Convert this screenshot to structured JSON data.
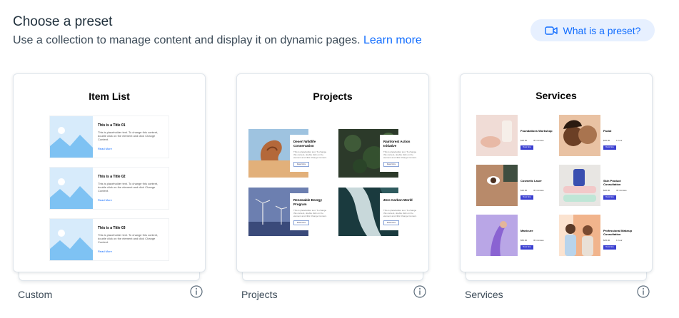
{
  "header": {
    "title": "Choose a preset",
    "subtitle": "Use a collection to manage content and display it on dynamic pages.",
    "learn_more": "Learn more",
    "help_button": "What is a preset?"
  },
  "presets": [
    {
      "title": "Item List",
      "footer": "Custom",
      "items": [
        {
          "title": "This is a Title 01",
          "desc": "This is placeholder text. To change this content, double click on the element and click Change Content.",
          "link": "Read More"
        },
        {
          "title": "This is a Title 02",
          "desc": "This is placeholder text. To change this content, double click on the element and click Change Content.",
          "link": "Read More"
        },
        {
          "title": "This is a Title 03",
          "desc": "This is placeholder text. To change this content, double click on the element and click Change Content.",
          "link": "Read More"
        }
      ]
    },
    {
      "title": "Projects",
      "footer": "Projects",
      "items": [
        {
          "name": "Desert Wildlife Conservation",
          "desc": "This is placeholder text. To change this content, double click on the element and click Change Content.",
          "button": "Read More"
        },
        {
          "name": "Rainforest Action Initiative",
          "desc": "This is placeholder text. To change this content, double click on the element and click Change Content.",
          "button": "Read More"
        },
        {
          "name": "Renewable Energy Program",
          "desc": "This is placeholder text. To change this content, double click on the element and click Change Content.",
          "button": "Read More"
        },
        {
          "name": "Zero Carbon World",
          "desc": "This is placeholder text. To change this content, double click on the element and click Change Content.",
          "button": "Read More"
        }
      ]
    },
    {
      "title": "Services",
      "footer": "Services",
      "items": [
        {
          "name": "Foundations Workshop",
          "price": "$25.00",
          "duration": "30 minutes",
          "button": "Book Now"
        },
        {
          "name": "Facial",
          "price": "$20.00",
          "duration": "1 hour",
          "button": "Book Now"
        },
        {
          "name": "Cosmetic Laser",
          "price": "$10.00",
          "duration": "30 minutes",
          "button": "Book Now"
        },
        {
          "name": "Skin Product Consultation",
          "price": "$20.00",
          "duration": "30 minutes",
          "button": "Book Now"
        },
        {
          "name": "Manicure",
          "price": "$50.00",
          "duration": "30 minutes",
          "button": "Book Now"
        },
        {
          "name": "Professional Makeup Consultation",
          "price": "$25.00",
          "duration": "1 hour",
          "button": "Book Now"
        }
      ]
    }
  ],
  "colors": {
    "accent": "#116dff",
    "pill_bg": "#e7f0ff",
    "book_button": "#3b3fd1"
  },
  "icons": {
    "help": "video-icon",
    "info": "info-icon",
    "placeholder": "image-placeholder-icon"
  }
}
